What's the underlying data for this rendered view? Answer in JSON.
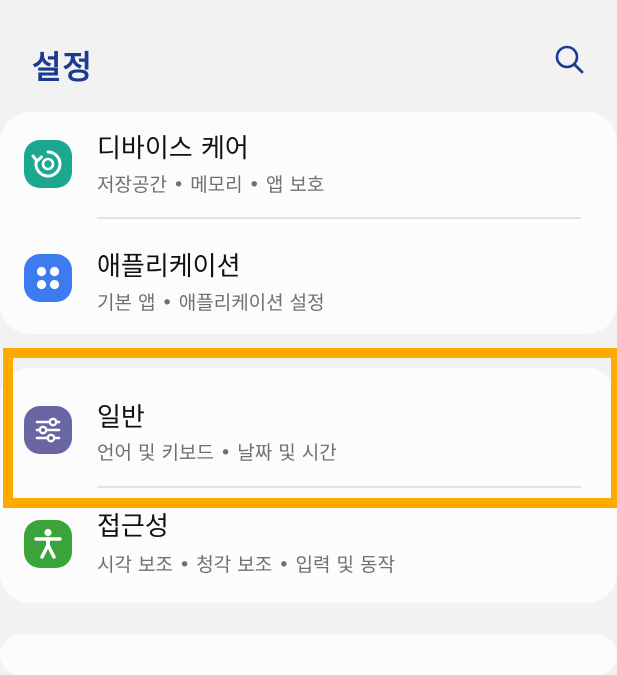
{
  "header": {
    "title": "설정",
    "search_icon": "search-icon"
  },
  "settings": [
    {
      "title": "디바이스 케어",
      "subtitle": "저장공간 • 메모리 • 앱 보호",
      "icon": "device-care-icon",
      "icon_color": "#1aa88f"
    },
    {
      "title": "애플리케이션",
      "subtitle": "기본 앱 • 애플리케이션 설정",
      "icon": "apps-grid-icon",
      "icon_color": "#3d7bf0"
    },
    {
      "title": "일반",
      "subtitle": "언어 및 키보드 • 날짜 및 시간",
      "icon": "sliders-icon",
      "icon_color": "#6a65a3"
    },
    {
      "title": "접근성",
      "subtitle": "시각 보조 • 청각 보조 • 입력 및 동작",
      "icon": "accessibility-icon",
      "icon_color": "#3aa33a"
    }
  ],
  "colors": {
    "title": "#1c3a8f",
    "background": "#f2f2f2",
    "card": "#fcfcfc",
    "highlight": "#ffaa00"
  }
}
